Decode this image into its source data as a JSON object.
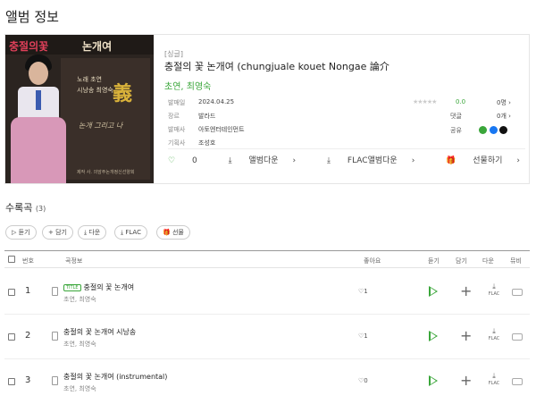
{
  "page_title": "앨범 정보",
  "cover": {
    "title_left": "충절의꽃",
    "title_right": "논개여",
    "credits": [
      "노래 초연",
      "시낭송 최영숙"
    ],
    "hanja": "義",
    "signature": "논개 그리고 나",
    "footer": "제작 사. 의암주논개정신선양회"
  },
  "album": {
    "type": "[싱글]",
    "title": "충절의 꽃 논개여 (chungjuale kouet Nongae 論介",
    "artist": "초연, 최영숙",
    "meta": [
      {
        "key": "발매일",
        "value": "2024.04.25"
      },
      {
        "key": "장르",
        "value": "발라드"
      },
      {
        "key": "발매사",
        "value": "아토엔터테인먼트"
      },
      {
        "key": "기획사",
        "value": "조성호"
      }
    ],
    "rating": "0.0",
    "rating_count": "0명",
    "comments_label": "댓글",
    "comments_value": "0개",
    "share_label": "공유"
  },
  "actions": {
    "like_count": "0",
    "album_download": "앨범다운",
    "flac_download": "FLAC앨범다운",
    "gift": "선물하기"
  },
  "tracklist": {
    "heading": "수록곡",
    "count": "(3)",
    "buttons": [
      "듣기",
      "담기",
      "다운",
      "FLAC",
      "선물"
    ],
    "columns": {
      "no": "번호",
      "info": "곡정보",
      "like": "좋아요",
      "listen": "듣기",
      "add": "담기",
      "down": "다운",
      "mv": "뮤비"
    },
    "flac_label": "FLAC",
    "title_badge": "TITLE",
    "tracks": [
      {
        "no": "1",
        "title": "충절의 꽃 논개여",
        "artist": "초연, 최영숙",
        "likes": "1",
        "is_title": true
      },
      {
        "no": "2",
        "title": "충절의 꽃 논개여 시낭송",
        "artist": "초연, 최영숙",
        "likes": "1",
        "is_title": false
      },
      {
        "no": "3",
        "title": "충절의 꽃 논개여 (instrumental)",
        "artist": "초연, 최영숙",
        "likes": "0",
        "is_title": false
      }
    ]
  },
  "colors": {
    "accent": "#3aa63a"
  }
}
